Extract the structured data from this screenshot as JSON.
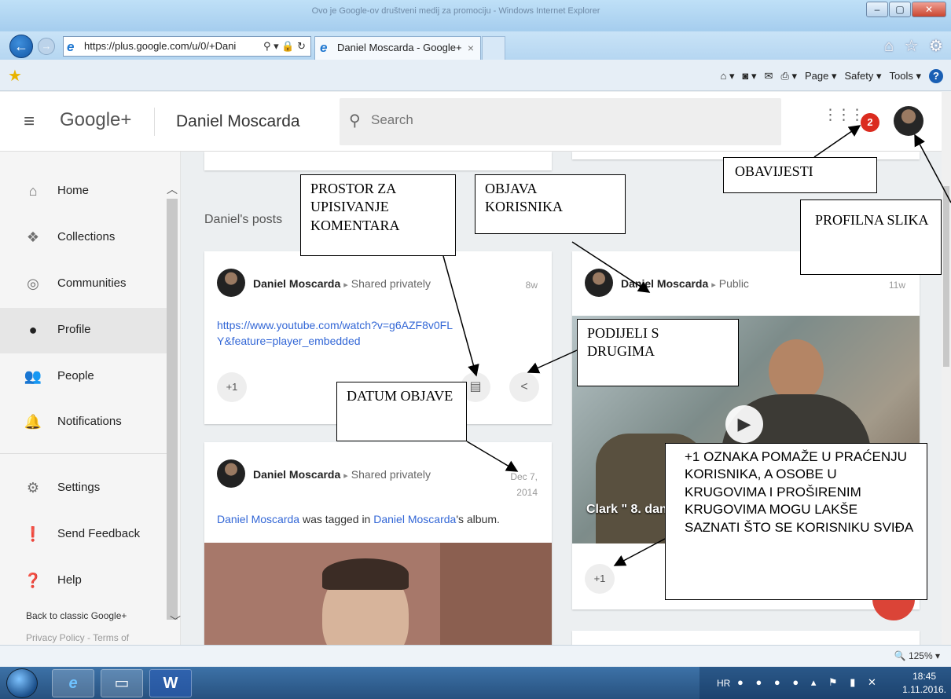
{
  "browser": {
    "title": "Ovo je Google-ov društveni medij za promociju - Windows Internet Explorer",
    "address": "https://plus.google.com/u/0/+Dani",
    "tab_title": "Daniel Moscarda - Google+",
    "tab_close": "×",
    "back_icon": "←",
    "forward_icon": "→",
    "address_tools": "⚲ ▾ 🔒 ↻",
    "toolbar_right": "⌂ ☆ ⚙",
    "cmd": {
      "page": "Page ▾",
      "safety": "Safety ▾",
      "tools": "Tools ▾",
      "home": "⌂ ▾",
      "feeds": "◙ ▾",
      "mail": "✉",
      "print": "⎙ ▾",
      "help": "?"
    },
    "zoom": "🔍 125%  ▾"
  },
  "header": {
    "logo": "Google+",
    "page_name": "Daniel Moscarda",
    "search_placeholder": "Search",
    "notification_count": "2"
  },
  "sidebar": {
    "items": [
      {
        "label": "Home",
        "icon": "home-icon"
      },
      {
        "label": "Collections",
        "icon": "collections-icon"
      },
      {
        "label": "Communities",
        "icon": "communities-icon"
      },
      {
        "label": "Profile",
        "icon": "profile-icon"
      },
      {
        "label": "People",
        "icon": "people-icon"
      },
      {
        "label": "Notifications",
        "icon": "bell-icon"
      },
      {
        "label": "Settings",
        "icon": "gear-icon"
      },
      {
        "label": "Send Feedback",
        "icon": "feedback-icon"
      },
      {
        "label": "Help",
        "icon": "help-icon"
      }
    ],
    "classic": "Back to classic Google+",
    "privacy": "Privacy Policy - Terms of"
  },
  "posts_heading": "Daniel's posts",
  "posts": [
    {
      "author": "Daniel Moscarda",
      "visibility": "Shared privately",
      "time": "8w",
      "link": "https://www.youtube.com/watch?v=g6AZF8v0FLY&feature=player_embedded",
      "plus_one": "+1"
    },
    {
      "author": "Daniel Moscarda",
      "visibility": "Shared privately",
      "time": "Dec 7, 2014",
      "text_before": "was tagged in",
      "text_link1": "Daniel Moscarda",
      "text_link2": "Daniel Moscarda",
      "text_after": "'s album."
    },
    {
      "author": "Daniel Moscarda",
      "visibility": "Public",
      "time": "11w",
      "caption": "Clark \" 8. dan",
      "plus_one": "+1"
    }
  ],
  "annotations": {
    "comment_space": "PROSTOR ZA UPISIVANJE KOMENTARA",
    "user_post": "OBJAVA KORISNIKA",
    "notifications": "OBAVIJESTI",
    "profile_pic": "PROFILNA SLIKA",
    "share": "PODIJELI S DRUGIMA",
    "post_date": "DATUM OBJAVE",
    "plus_one": "+1 OZNAKA POMAŽE U PRAĆENJU KORISNIKA, A OSOBE U KRUGOVIMA I PROŠIRENIM KRUGOVIMA MOGU LAKŠE SAZNATI ŠTO SE KORISNIKU SVIĐA"
  },
  "taskbar": {
    "lang": "HR",
    "time": "18:45",
    "date": "1.11.2016.",
    "word_icon": "W"
  }
}
